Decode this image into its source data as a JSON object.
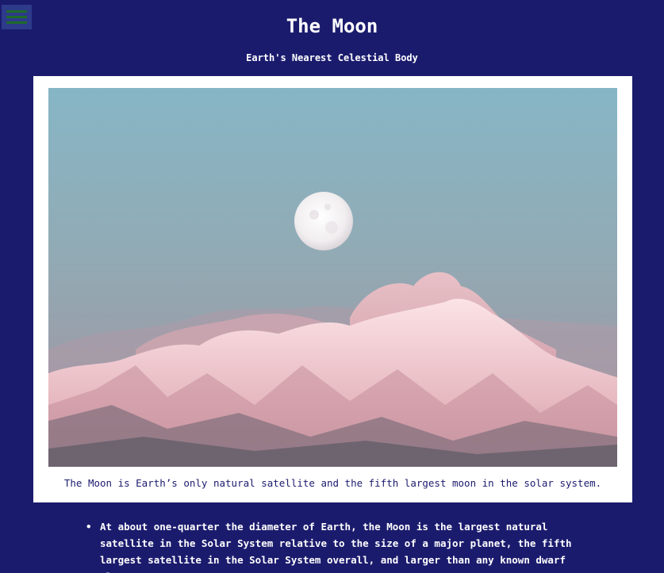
{
  "header": {
    "menu_icon": "hamburger-icon",
    "title": "The Moon",
    "subtitle": "Earth's Nearest Celestial Body"
  },
  "figure": {
    "image_description": "moon-over-snowy-mountains",
    "caption": "The Moon is Earth’s only natural satellite and the fifth largest moon in the solar system."
  },
  "facts": [
    {
      "text": "At about one-quarter the diameter of Earth, the Moon is the largest natural satellite in the Solar System relative to the size of a major planet, the fifth largest satellite in the Solar System overall, and larger than any known dwarf planet."
    }
  ],
  "colors": {
    "background": "#1b1b6e",
    "text": "#ffffff",
    "menu_button": "#2d3b8a",
    "menu_bars": "#1f6b2a",
    "figure_frame": "#ffffff",
    "caption_text": "#1b1b6e"
  }
}
